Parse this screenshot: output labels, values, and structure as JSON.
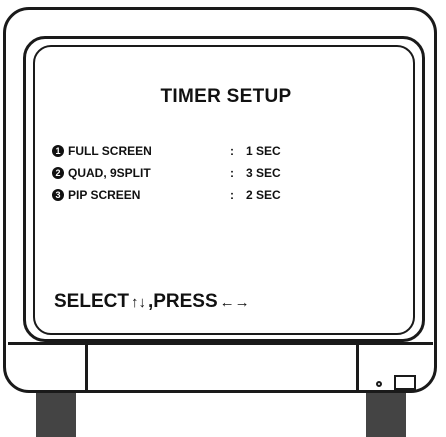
{
  "osd": {
    "title": "TIMER SETUP",
    "items": [
      {
        "num": "1",
        "label": "FULL SCREEN",
        "value": "1 SEC"
      },
      {
        "num": "2",
        "label": "QUAD, 9SPLIT",
        "value": "3 SEC"
      },
      {
        "num": "3",
        "label": "PIP SCREEN",
        "value": "2 SEC"
      }
    ],
    "colon": ":",
    "footer": {
      "select": "SELECT",
      "select_arrows": "↑↓",
      "press": ",PRESS",
      "press_arrows": "←→"
    }
  }
}
